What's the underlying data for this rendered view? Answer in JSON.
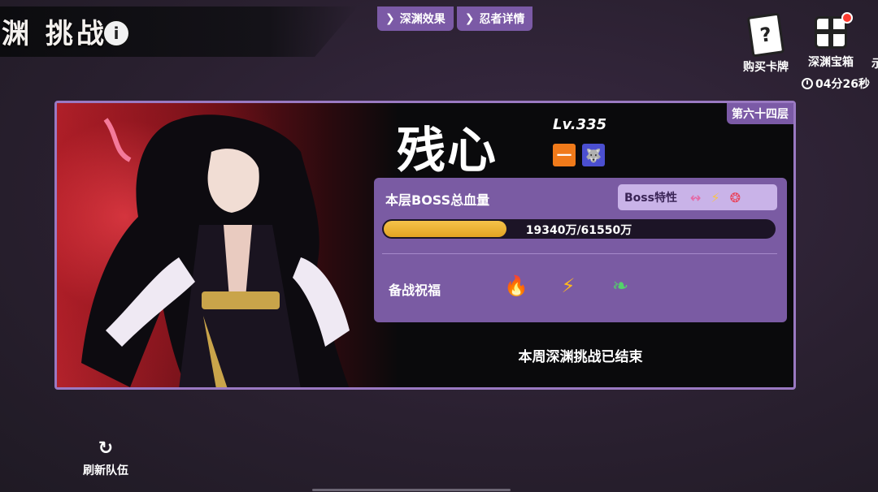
{
  "header": {
    "title": "渊 挑战",
    "info_glyph": "i",
    "tabs": [
      {
        "label": "深渊效果"
      },
      {
        "label": "忍者详情"
      }
    ],
    "right_buttons": [
      {
        "label": "购买卡牌",
        "icon": "card-question-icon",
        "glyph": "?"
      },
      {
        "label": "深渊宝箱",
        "icon": "gift-box-icon",
        "has_notification": true
      }
    ],
    "edge_text": "示",
    "timer": "04分26秒"
  },
  "boss": {
    "name": "残心",
    "level": "Lv.335",
    "floor": "第六十四层",
    "badge_one": "一",
    "badge_type_icon": "wolf-icon",
    "hp_label": "本层BOSS总血量",
    "hp_text": "19340万/61550万",
    "hp_current": 19340,
    "hp_max": 61550,
    "trait_label": "Boss特性",
    "traits": [
      {
        "icon": "boomerang-icon",
        "glyph": "↭",
        "color": "#e36aa6"
      },
      {
        "icon": "lightning-icon",
        "glyph": "⚡",
        "color": "#f6c44a"
      },
      {
        "icon": "flame-swirl-icon",
        "glyph": "❂",
        "color": "#e9425a"
      }
    ]
  },
  "blessing": {
    "label": "备战祝福",
    "icons": [
      {
        "icon": "fire-icon",
        "glyph": "🔥",
        "color": "#ff4a2d"
      },
      {
        "icon": "lightning-icon",
        "glyph": "⚡",
        "color": "#ffb81f"
      },
      {
        "icon": "leaf-icon",
        "glyph": "❧",
        "color": "#53d36a"
      }
    ]
  },
  "status": {
    "week_ended": "本周深渊挑战已结束"
  },
  "footer": {
    "refresh_label": "刷新队伍"
  }
}
